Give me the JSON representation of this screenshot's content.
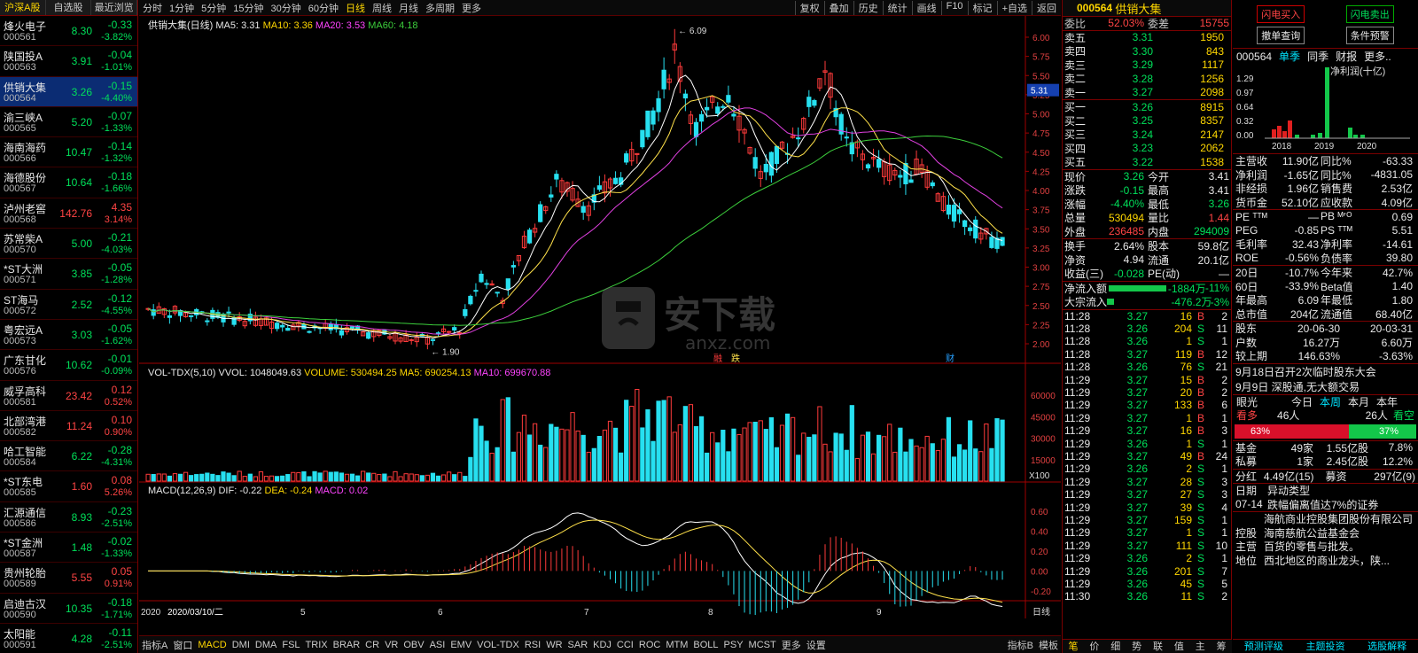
{
  "left_header": [
    "沪深A股",
    "自选股",
    "最近浏览"
  ],
  "stocks": [
    {
      "name": "烽火电子",
      "code": "000561",
      "price": "8.30",
      "chg": "-0.33",
      "pct": "-3.82%",
      "dir": "dn"
    },
    {
      "name": "陕国投A",
      "code": "000563",
      "price": "3.91",
      "chg": "-0.04",
      "pct": "-1.01%",
      "dir": "dn"
    },
    {
      "name": "供销大集",
      "code": "000564",
      "price": "3.26",
      "chg": "-0.15",
      "pct": "-4.40%",
      "dir": "dn"
    },
    {
      "name": "渝三峡A",
      "code": "000565",
      "price": "5.20",
      "chg": "-0.07",
      "pct": "-1.33%",
      "dir": "dn"
    },
    {
      "name": "海南海药",
      "code": "000566",
      "price": "10.47",
      "chg": "-0.14",
      "pct": "-1.32%",
      "dir": "dn"
    },
    {
      "name": "海德股份",
      "code": "000567",
      "price": "10.64",
      "chg": "-0.18",
      "pct": "-1.66%",
      "dir": "dn"
    },
    {
      "name": "泸州老窖",
      "code": "000568",
      "price": "142.76",
      "chg": "4.35",
      "pct": "3.14%",
      "dir": "up"
    },
    {
      "name": "苏常柴A",
      "code": "000570",
      "price": "5.00",
      "chg": "-0.21",
      "pct": "-4.03%",
      "dir": "dn"
    },
    {
      "name": "*ST大洲",
      "code": "000571",
      "price": "3.85",
      "chg": "-0.05",
      "pct": "-1.28%",
      "dir": "dn"
    },
    {
      "name": "ST海马",
      "code": "000572",
      "price": "2.52",
      "chg": "-0.12",
      "pct": "-4.55%",
      "dir": "dn"
    },
    {
      "name": "粤宏远A",
      "code": "000573",
      "price": "3.03",
      "chg": "-0.05",
      "pct": "-1.62%",
      "dir": "dn"
    },
    {
      "name": "广东甘化",
      "code": "000576",
      "price": "10.62",
      "chg": "-0.01",
      "pct": "-0.09%",
      "dir": "dn"
    },
    {
      "name": "威孚高科",
      "code": "000581",
      "price": "23.42",
      "chg": "0.12",
      "pct": "0.52%",
      "dir": "up"
    },
    {
      "name": "北部湾港",
      "code": "000582",
      "price": "11.24",
      "chg": "0.10",
      "pct": "0.90%",
      "dir": "up"
    },
    {
      "name": "哈工智能",
      "code": "000584",
      "price": "6.22",
      "chg": "-0.28",
      "pct": "-4.31%",
      "dir": "dn"
    },
    {
      "name": "*ST东电",
      "code": "000585",
      "price": "1.60",
      "chg": "0.08",
      "pct": "5.26%",
      "dir": "up"
    },
    {
      "name": "汇源通信",
      "code": "000586",
      "price": "8.93",
      "chg": "-0.23",
      "pct": "-2.51%",
      "dir": "dn"
    },
    {
      "name": "*ST金洲",
      "code": "000587",
      "price": "1.48",
      "chg": "-0.02",
      "pct": "-1.33%",
      "dir": "dn"
    },
    {
      "name": "贵州轮胎",
      "code": "000589",
      "price": "5.55",
      "chg": "0.05",
      "pct": "0.91%",
      "dir": "up"
    },
    {
      "name": "启迪古汉",
      "code": "000590",
      "price": "10.35",
      "chg": "-0.18",
      "pct": "-1.71%",
      "dir": "dn"
    },
    {
      "name": "太阳能",
      "code": "000591",
      "price": "4.28",
      "chg": "-0.11",
      "pct": "-2.51%",
      "dir": "dn"
    }
  ],
  "period_tabs": [
    "分时",
    "1分钟",
    "5分钟",
    "15分钟",
    "30分钟",
    "60分钟",
    "日线",
    "周线",
    "月线",
    "多周期",
    "更多"
  ],
  "active_period": "日线",
  "tool_tabs": [
    "复权",
    "叠加",
    "历史",
    "统计",
    "画线",
    "F10",
    "标记",
    "+自选",
    "返回"
  ],
  "main": {
    "title": "供销大集(日线)",
    "ma5": "MA5: 3.31",
    "ma10": "MA10: 3.36",
    "ma20": "MA20: 3.53",
    "ma60": "MA60: 4.18",
    "hi": "6.09",
    "lo": "1.90",
    "last": "5.31",
    "ticks": [
      "6.00",
      "5.75",
      "5.50",
      "5.25",
      "5.00",
      "4.75",
      "4.50",
      "4.25",
      "4.00",
      "3.75",
      "3.50",
      "3.25",
      "3.00",
      "2.75",
      "2.50",
      "2.25",
      "2.00"
    ],
    "marks": [
      "融",
      "跌",
      "财"
    ]
  },
  "vol": {
    "title": "VOL-TDX(5,10)",
    "vvol": "VVOL: 1048049.63",
    "volume": "VOLUME: 530494.25",
    "ma5": "MA5: 690254.13",
    "ma10": "MA10: 699670.88",
    "ticks": [
      "60000",
      "45000",
      "30000",
      "15000"
    ],
    "unit": "X100"
  },
  "macd": {
    "title": "MACD(12,26,9)",
    "dif": "DIF: -0.22",
    "dea": "DEA: -0.24",
    "macd": "MACD: 0.02",
    "ticks": [
      "0.60",
      "0.40",
      "0.20",
      "0.00",
      "-0.20"
    ]
  },
  "dates": [
    "2020",
    "2020/03/10/二",
    "5",
    "6",
    "7",
    "8",
    "9"
  ],
  "period_label": "日线",
  "indicator_tabs": [
    "指标A",
    "窗口",
    "MACD",
    "DMI",
    "DMA",
    "FSL",
    "TRIX",
    "BRAR",
    "CR",
    "VR",
    "OBV",
    "ASI",
    "EMV",
    "VOL-TDX",
    "RSI",
    "WR",
    "SAR",
    "KDJ",
    "CCI",
    "ROC",
    "MTM",
    "BOLL",
    "PSY",
    "MCST",
    "更多",
    "设置"
  ],
  "footer_tabs": [
    "扩展A",
    "关联报价",
    "综合资讯",
    "行业资讯"
  ],
  "footer_right": [
    "指标B",
    "模板"
  ],
  "quote": {
    "code": "000564",
    "name": "供销大集",
    "weibi_label": "委比",
    "weibi": "52.03%",
    "weicha_label": "委差",
    "weicha": "15755",
    "asks": [
      [
        "卖五",
        "3.31",
        "1950"
      ],
      [
        "卖四",
        "3.30",
        "843"
      ],
      [
        "卖三",
        "3.29",
        "1117"
      ],
      [
        "卖二",
        "3.28",
        "1256"
      ],
      [
        "卖一",
        "3.27",
        "2098"
      ]
    ],
    "bids": [
      [
        "买一",
        "3.26",
        "8915"
      ],
      [
        "买二",
        "3.25",
        "8357"
      ],
      [
        "买三",
        "3.24",
        "2147"
      ],
      [
        "买四",
        "3.23",
        "2062"
      ],
      [
        "买五",
        "3.22",
        "1538"
      ]
    ],
    "stats": [
      [
        "现价",
        "3.26",
        "今开",
        "3.41"
      ],
      [
        "涨跌",
        "-0.15",
        "最高",
        "3.41"
      ],
      [
        "涨幅",
        "-4.40%",
        "最低",
        "3.26"
      ],
      [
        "总量",
        "530494",
        "量比",
        "1.44"
      ],
      [
        "外盘",
        "236485",
        "内盘",
        "294009"
      ]
    ],
    "stats2": [
      [
        "换手",
        "2.64%",
        "股本",
        "59.8亿"
      ],
      [
        "净资",
        "4.94",
        "流通",
        "20.1亿"
      ],
      [
        "收益(三)",
        "-0.028",
        "PE(动)",
        "—"
      ]
    ],
    "flow": [
      [
        "净流入额",
        "-1884万",
        "-11%"
      ],
      [
        "大宗流入",
        "-476.2万",
        "-3%"
      ]
    ],
    "ticks": [
      [
        "11:28",
        "3.27",
        "16",
        "B",
        "2"
      ],
      [
        "11:28",
        "3.26",
        "204",
        "S",
        "11"
      ],
      [
        "11:28",
        "3.26",
        "1",
        "S",
        "1"
      ],
      [
        "11:28",
        "3.27",
        "119",
        "B",
        "12"
      ],
      [
        "11:28",
        "3.26",
        "76",
        "S",
        "21"
      ],
      [
        "11:29",
        "3.27",
        "15",
        "B",
        "2"
      ],
      [
        "11:29",
        "3.27",
        "20",
        "B",
        "2"
      ],
      [
        "11:29",
        "3.27",
        "133",
        "B",
        "6"
      ],
      [
        "11:29",
        "3.27",
        "1",
        "B",
        "1"
      ],
      [
        "11:29",
        "3.27",
        "16",
        "B",
        "3"
      ],
      [
        "11:29",
        "3.26",
        "1",
        "S",
        "1"
      ],
      [
        "11:29",
        "3.27",
        "49",
        "B",
        "24"
      ],
      [
        "11:29",
        "3.26",
        "2",
        "S",
        "1"
      ],
      [
        "11:29",
        "3.27",
        "28",
        "S",
        "3"
      ],
      [
        "11:29",
        "3.27",
        "27",
        "S",
        "3"
      ],
      [
        "11:29",
        "3.27",
        "39",
        "S",
        "4"
      ],
      [
        "11:29",
        "3.27",
        "159",
        "S",
        "1"
      ],
      [
        "11:29",
        "3.27",
        "1",
        "S",
        "1"
      ],
      [
        "11:29",
        "3.27",
        "111",
        "S",
        "10"
      ],
      [
        "11:29",
        "3.26",
        "2",
        "S",
        "1"
      ],
      [
        "11:29",
        "3.26",
        "201",
        "S",
        "7"
      ],
      [
        "11:29",
        "3.26",
        "45",
        "S",
        "5"
      ],
      [
        "11:30",
        "3.26",
        "11",
        "S",
        "2"
      ]
    ],
    "bottom_tabs": [
      "笔",
      "价",
      "细",
      "势",
      "联",
      "值",
      "主",
      "筹"
    ]
  },
  "f10": {
    "btn_buy": "闪电买入",
    "btn_sell": "闪电卖出",
    "btn_query": "撤单查询",
    "btn_alert": "条件预警",
    "code": "000564",
    "tabs": [
      "单季",
      "同季",
      "财报",
      "更多.."
    ],
    "active_tab": "单季",
    "chart_title": "净利润(十亿)",
    "chart_yticks": [
      "1.29",
      "0.97",
      "0.64",
      "0.32",
      "0.00"
    ],
    "chart_years": [
      "2018",
      "2019",
      "2020"
    ],
    "fin": [
      [
        "主营收",
        "11.90亿",
        "同比%",
        "-63.33"
      ],
      [
        "净利润",
        "-1.65亿",
        "同比%",
        "-4831.05"
      ],
      [
        "非经损",
        "1.96亿",
        "销售费",
        "2.53亿"
      ],
      [
        "货币金",
        "52.10亿",
        "应收款",
        "4.09亿"
      ]
    ],
    "val": [
      [
        "PE ᵀᵀᴹ",
        "—",
        "PB ᴹᣴᴼ",
        "0.69"
      ],
      [
        "PEG",
        "-0.85",
        "PS ᵀᵀᴹ",
        "5.51"
      ],
      [
        "毛利率",
        "32.43",
        "净利率",
        "-14.61"
      ],
      [
        "ROE",
        "-0.56%",
        "负债率",
        "39.80"
      ]
    ],
    "perf": [
      [
        "20日",
        "-10.7%",
        "今年来",
        "42.7%"
      ],
      [
        "60日",
        "-33.9%",
        "Beta值",
        "1.40"
      ],
      [
        "年最高",
        "6.09",
        "年最低",
        "1.80"
      ],
      [
        "总市值",
        "204亿",
        "流通值",
        "68.40亿"
      ]
    ],
    "holders": [
      [
        "股东",
        "20-06-30",
        "20-03-31"
      ],
      [
        "户数",
        "16.27万",
        "6.60万"
      ],
      [
        "较上期",
        "146.63%",
        "-3.63%"
      ]
    ],
    "news": [
      "9月18日召开2次临时股东大会",
      "9月9日 深股通,无大额交易"
    ],
    "eye_label": "眼光",
    "eye_tabs": [
      "今日",
      "本周",
      "本月",
      "本年"
    ],
    "eye_active": "本周",
    "bull_label": "看多",
    "bull_count": "46人",
    "bear_count": "26人",
    "bear_label": "看空",
    "bull_pct": "63%",
    "bear_pct": "37%",
    "funds": [
      [
        "基金",
        "49家",
        "1.55亿股",
        "7.8%"
      ],
      [
        "私募",
        "1家",
        "2.45亿股",
        "12.2%"
      ]
    ],
    "div": [
      "分红",
      "4.49亿(15)",
      "募资",
      "297亿(9)"
    ],
    "events_head": [
      "日期",
      "异动类型"
    ],
    "events": [
      [
        "07-14",
        "跌幅偏离值达7%的证券"
      ]
    ],
    "company": [
      [
        "",
        "海航商业控股集团股份有限公司"
      ],
      [
        "控股",
        "海南慈航公益基金会"
      ],
      [
        "主营",
        "百货的零售与批发。"
      ],
      [
        "地位",
        "西北地区的商业龙头，陕..."
      ]
    ],
    "footer": [
      "预测评级",
      "主题投资",
      "选股解释"
    ]
  }
}
